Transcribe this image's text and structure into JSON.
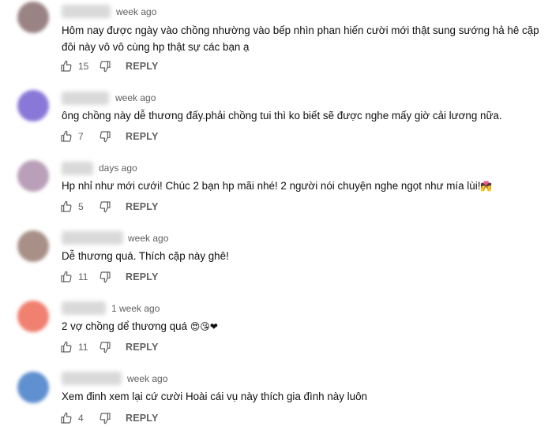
{
  "comments": [
    {
      "time": "week ago",
      "text": "Hôm nay được ngày vào chồng nhường vào bếp nhìn phan hiến cười mới thật sung sướng hả hê cặp đôi này vô vô cùng hp thật sự các bạn ạ",
      "likes": "15",
      "reply": "REPLY",
      "avatar_color": "#9a8483"
    },
    {
      "time": "week ago",
      "text": "ông chồng này dễ thương đấy.phải chồng tui thì ko biết sẽ được nghe mấy giờ cải lương nữa.",
      "likes": "7",
      "reply": "REPLY",
      "avatar_color": "#8a78d8"
    },
    {
      "time": "days ago",
      "text": "Hp nhỉ như mới cưới! Chúc 2 bạn hp mãi nhé! 2 người nói chuyện nghe ngọt như mía lùi!",
      "emoji": "💏",
      "likes": "5",
      "reply": "REPLY",
      "avatar_color": "#b9a0b8"
    },
    {
      "time": "week ago",
      "text": "Dễ thương quá. Thích cặp này ghê!",
      "likes": "11",
      "reply": "REPLY",
      "avatar_color": "#a89088"
    },
    {
      "time": "1 week ago",
      "text": "2 vợ chồng dể thương quá",
      "emoji": "😍😘❤",
      "likes": "11",
      "reply": "REPLY",
      "avatar_color": "#f08070"
    },
    {
      "time": "week ago",
      "text": "Xem đinh xem lại cứ cười Hoài cái vụ này thích gia đình này luôn",
      "likes": "4",
      "reply": "REPLY",
      "avatar_color": "#5f90d0"
    }
  ]
}
